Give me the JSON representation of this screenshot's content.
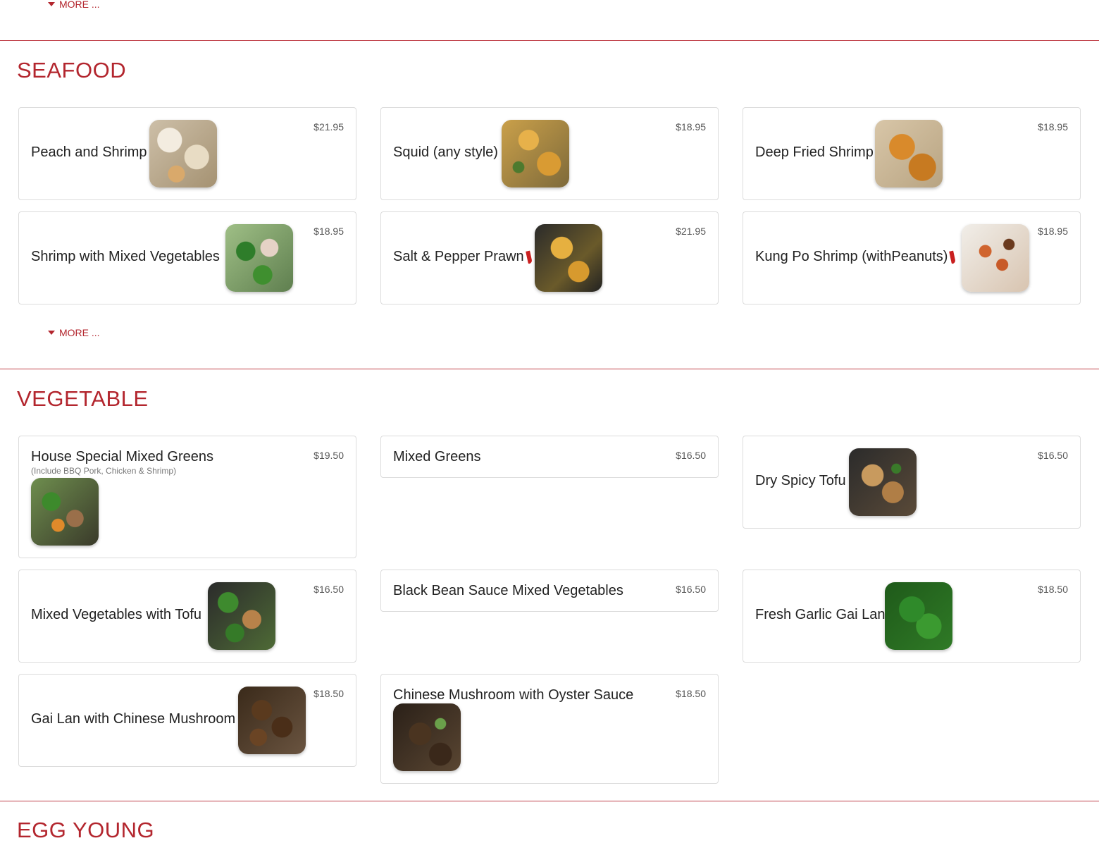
{
  "top_more": {
    "label": "MORE ..."
  },
  "seafood": {
    "title": "SEAFOOD",
    "more_label": "MORE ...",
    "items": [
      {
        "name": "Peach and Shrimp",
        "price": "$21.95",
        "thumb": "shrimp-photo"
      },
      {
        "name": "Squid (any style)",
        "price": "$18.95",
        "thumb": "squid-photo"
      },
      {
        "name": "Deep Fried Shrimp",
        "price": "$18.95",
        "thumb": "fried-shrimp-photo"
      },
      {
        "name": "Shrimp with Mixed Vegetables",
        "price": "$18.95",
        "thumb": "shrimp-vegetables-photo"
      },
      {
        "name": "Salt & Pepper Prawn",
        "price": "$21.95",
        "spicy": true,
        "thumb": "prawn-photo"
      },
      {
        "name": "Kung Po Shrimp (withPeanuts)",
        "price": "$18.95",
        "spicy": true,
        "thumb": "kung-po-photo"
      }
    ]
  },
  "vegetable": {
    "title": "VEGETABLE",
    "items": [
      {
        "name": "House Special Mixed Greens",
        "note": "(Include BBQ Pork, Chicken & Shrimp)",
        "price": "$19.50",
        "thumb": "mixed-greens-photo"
      },
      {
        "name": "Mixed Greens",
        "price": "$16.50"
      },
      {
        "name": "Dry Spicy Tofu",
        "price": "$16.50",
        "thumb": "tofu-photo"
      },
      {
        "name": "Mixed Vegetables with Tofu",
        "price": "$16.50",
        "thumb": "vegetables-tofu-photo"
      },
      {
        "name": "Black Bean Sauce Mixed Vegetables",
        "price": "$16.50"
      },
      {
        "name": "Fresh Garlic Gai Lan",
        "price": "$18.50",
        "thumb": "gai-lan-photo"
      },
      {
        "name": "Gai Lan with Chinese Mushroom",
        "price": "$18.50",
        "thumb": "mushroom-photo"
      },
      {
        "name": "Chinese Mushroom with Oyster Sauce",
        "price": "$18.50",
        "thumb": "oyster-mushroom-photo"
      }
    ]
  },
  "next_section": {
    "title": "EGG YOUNG"
  },
  "colors": {
    "accent": "#b3262e",
    "border": "#dcdcdc",
    "price": "#555555"
  }
}
